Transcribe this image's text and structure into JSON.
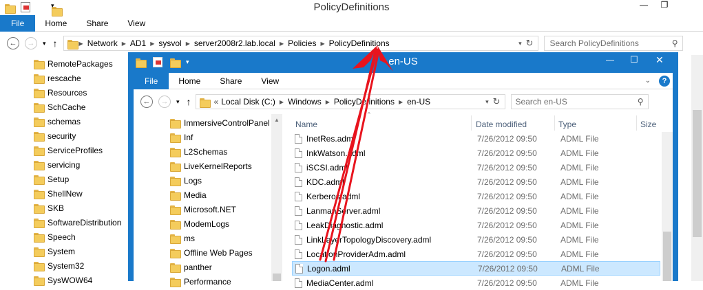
{
  "outer": {
    "title": "PolicyDefinitions",
    "ribbon_tabs": [
      "File",
      "Home",
      "Share",
      "View"
    ],
    "breadcrumb": [
      "Network",
      "AD1",
      "sysvol",
      "server2008r2.lab.local",
      "Policies",
      "PolicyDefinitions"
    ],
    "search_placeholder": "Search PolicyDefinitions",
    "tree": [
      "RemotePackages",
      "rescache",
      "Resources",
      "SchCache",
      "schemas",
      "security",
      "ServiceProfiles",
      "servicing",
      "Setup",
      "ShellNew",
      "SKB",
      "SoftwareDistribution",
      "Speech",
      "System",
      "System32",
      "SysWOW64"
    ]
  },
  "inner": {
    "title": "en-US",
    "ribbon_tabs": [
      "File",
      "Home",
      "Share",
      "View"
    ],
    "breadcrumb_prefix": "«",
    "breadcrumb": [
      "Local Disk (C:)",
      "Windows",
      "PolicyDefinitions",
      "en-US"
    ],
    "search_placeholder": "Search en-US",
    "tree": [
      "ImmersiveControlPanel",
      "Inf",
      "L2Schemas",
      "LiveKernelReports",
      "Logs",
      "Media",
      "Microsoft.NET",
      "ModemLogs",
      "ms",
      "Offline Web Pages",
      "panther",
      "Performance"
    ],
    "columns": {
      "name": "Name",
      "date": "Date modified",
      "type": "Type",
      "size": "Size"
    },
    "files": [
      {
        "name": "InetRes.adml",
        "date": "7/26/2012 09:50",
        "type": "ADML File"
      },
      {
        "name": "InkWatson.adml",
        "date": "7/26/2012 09:50",
        "type": "ADML File"
      },
      {
        "name": "iSCSI.adml",
        "date": "7/26/2012 09:50",
        "type": "ADML File"
      },
      {
        "name": "KDC.adml",
        "date": "7/26/2012 09:50",
        "type": "ADML File"
      },
      {
        "name": "Kerberos.adml",
        "date": "7/26/2012 09:50",
        "type": "ADML File"
      },
      {
        "name": "LanmanServer.adml",
        "date": "7/26/2012 09:50",
        "type": "ADML File"
      },
      {
        "name": "LeakDiagnostic.adml",
        "date": "7/26/2012 09:50",
        "type": "ADML File"
      },
      {
        "name": "LinkLayerTopologyDiscovery.adml",
        "date": "7/26/2012 09:50",
        "type": "ADML File"
      },
      {
        "name": "LocationProviderAdm.adml",
        "date": "7/26/2012 09:50",
        "type": "ADML File"
      },
      {
        "name": "Logon.adml",
        "date": "7/26/2012 09:50",
        "type": "ADML File"
      },
      {
        "name": "MediaCenter.adml",
        "date": "7/26/2012 09:50",
        "type": "ADML File"
      }
    ],
    "selected_index": 9
  },
  "colors": {
    "accent": "#1979ca",
    "inner_frame": "#1979ca",
    "selection": "#cce8ff",
    "arrow": "#e8141e"
  }
}
